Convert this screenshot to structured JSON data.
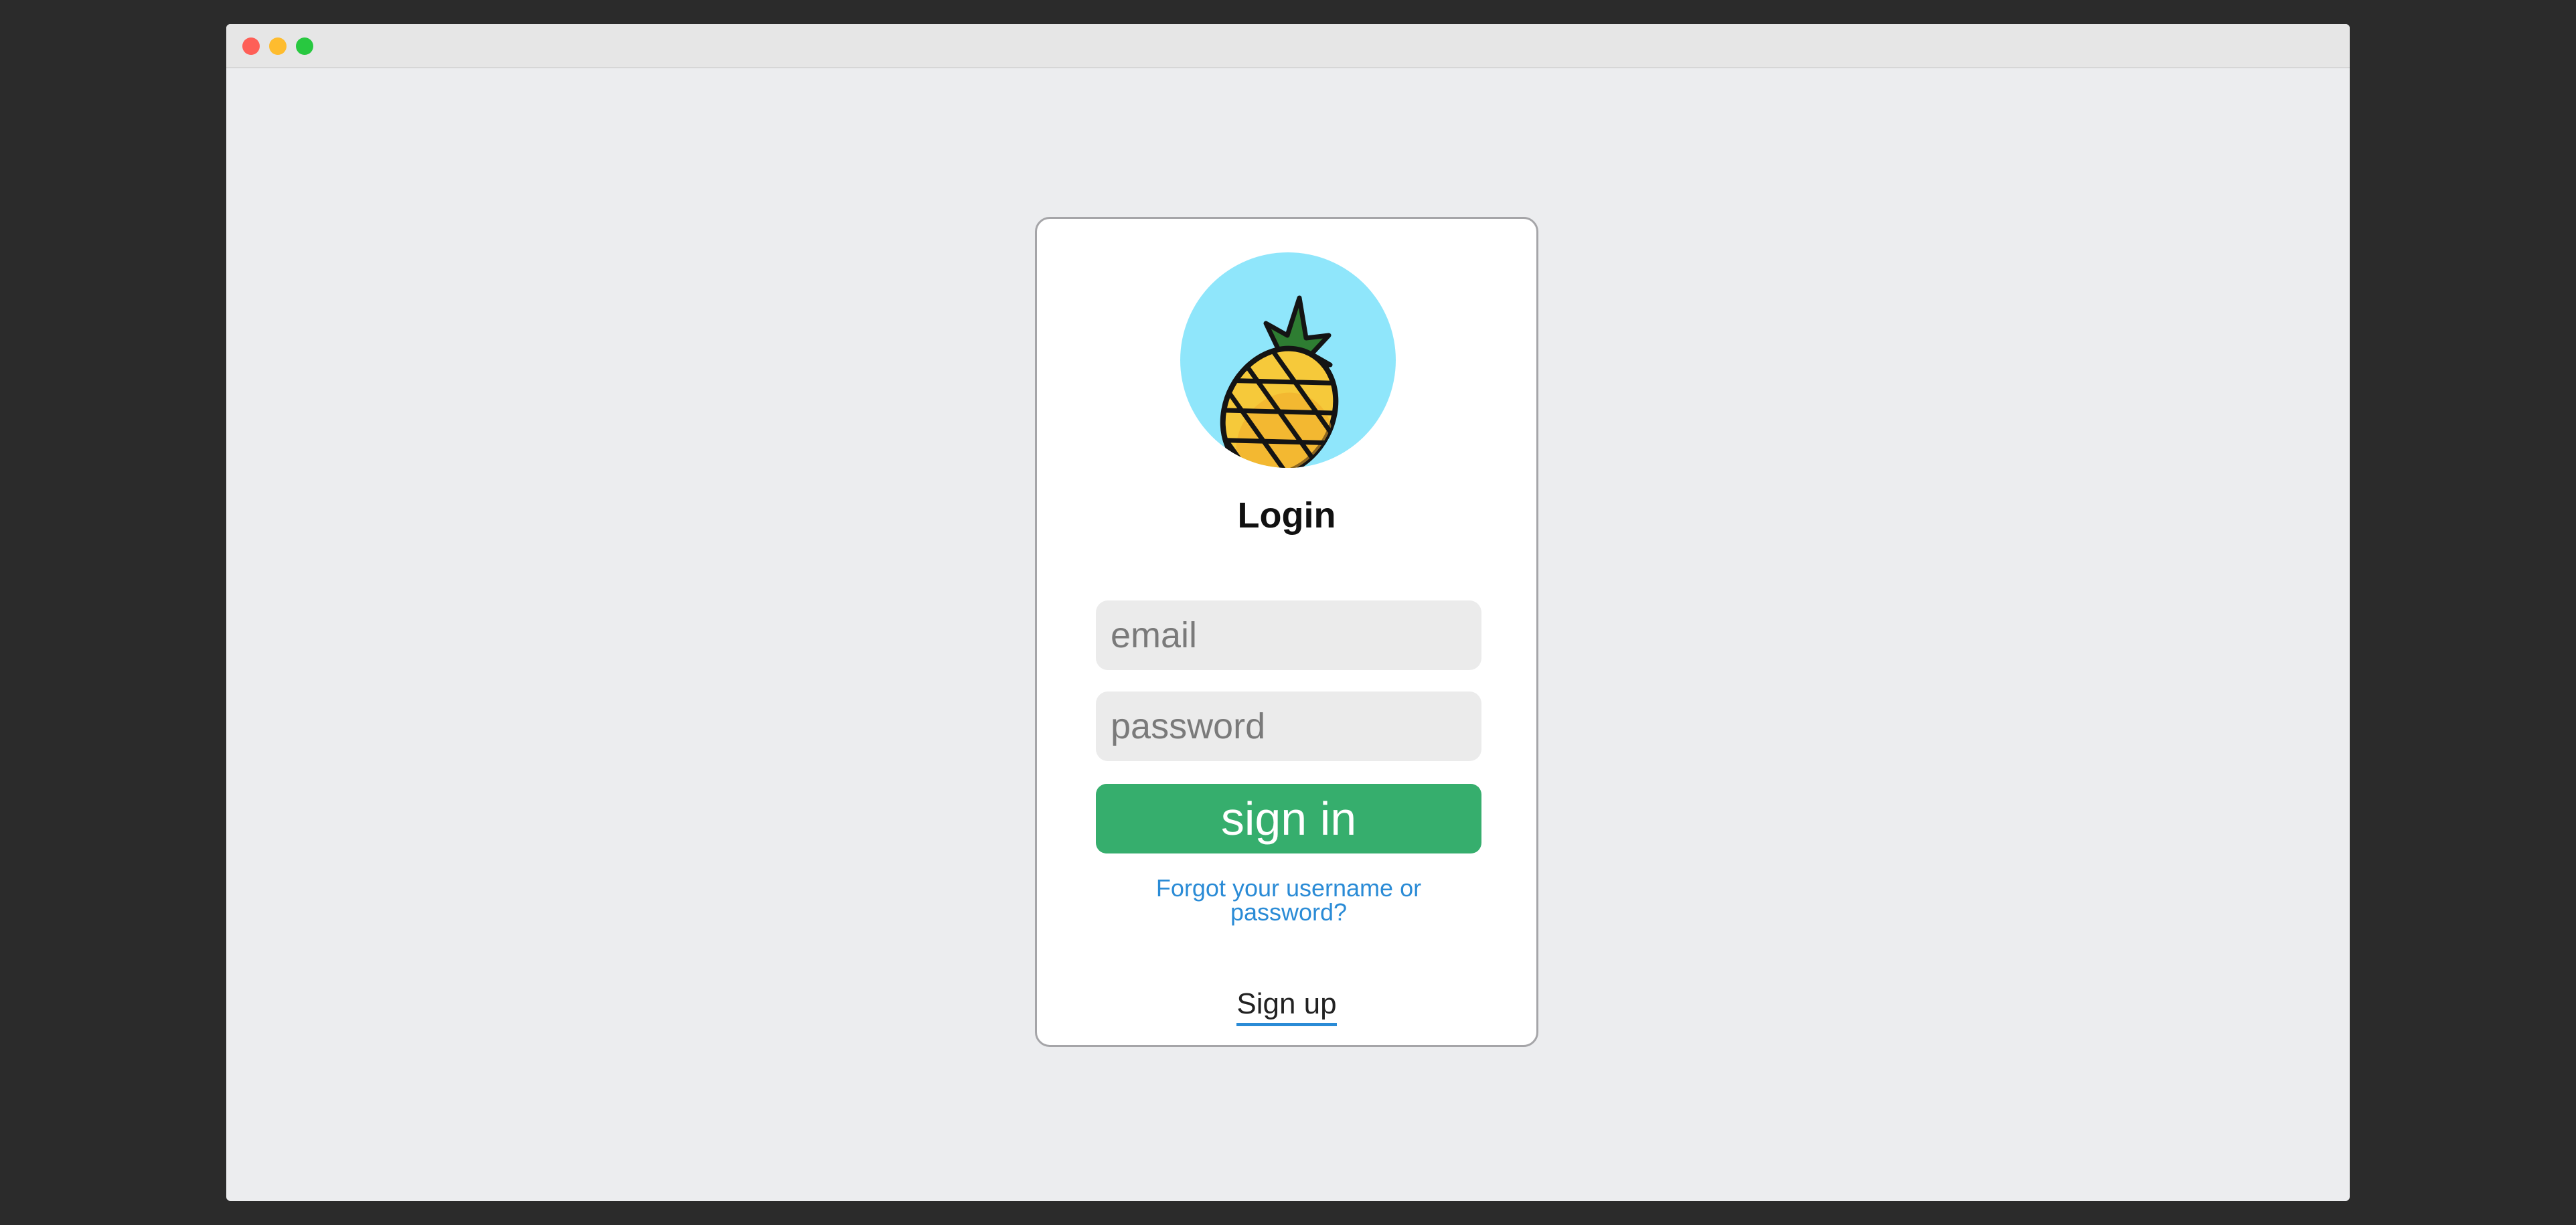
{
  "window": {
    "controls": [
      "close",
      "minimize",
      "maximize"
    ]
  },
  "login": {
    "logo_icon": "pineapple-icon",
    "title": "Login",
    "email_placeholder": "email",
    "password_placeholder": "password",
    "submit_label": "sign in",
    "forgot_link": "Forgot your username or password?",
    "signup_link": "Sign up"
  },
  "colors": {
    "background": "#ecedef",
    "avatar_bg": "#8fe6fb",
    "submit_bg": "#36ae6d",
    "link": "#2a8bd6",
    "field_bg": "#ebebeb"
  }
}
